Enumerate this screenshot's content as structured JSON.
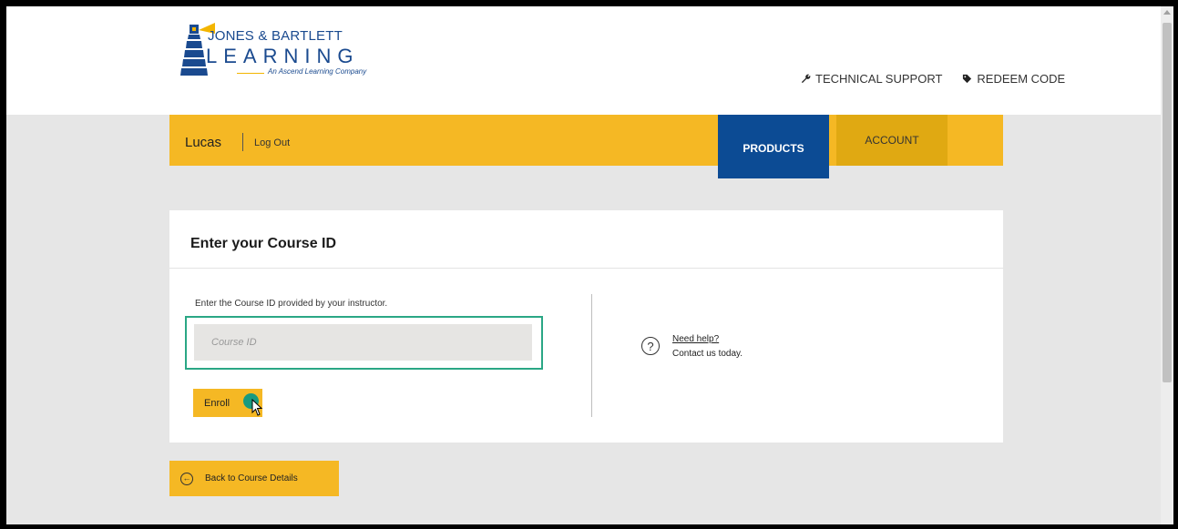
{
  "brand": {
    "line1": "JONES & BARTLETT",
    "line2": "LEARNING",
    "tagline": "An Ascend Learning Company",
    "primary_color": "#0c4b94",
    "accent_color": "#f5b824"
  },
  "top_links": [
    {
      "label": "TECHNICAL SUPPORT",
      "icon": "wrench-icon"
    },
    {
      "label": "REDEEM CODE",
      "icon": "tag-icon"
    }
  ],
  "nav": {
    "user": "Lucas",
    "logout": "Log Out",
    "tabs": [
      {
        "label": "PRODUCTS",
        "active": true
      },
      {
        "label": "ACCOUNT",
        "active": false
      }
    ]
  },
  "card": {
    "title": "Enter your Course ID",
    "instruction": "Enter the Course ID provided by your instructor.",
    "input": {
      "value": "",
      "placeholder": "Course ID"
    },
    "enroll_label": "Enroll",
    "help_link": "Need help?",
    "help_sub": "Contact us today.",
    "focus_color": "#2aa785"
  },
  "back_button": {
    "label": "Back to Course Details"
  }
}
